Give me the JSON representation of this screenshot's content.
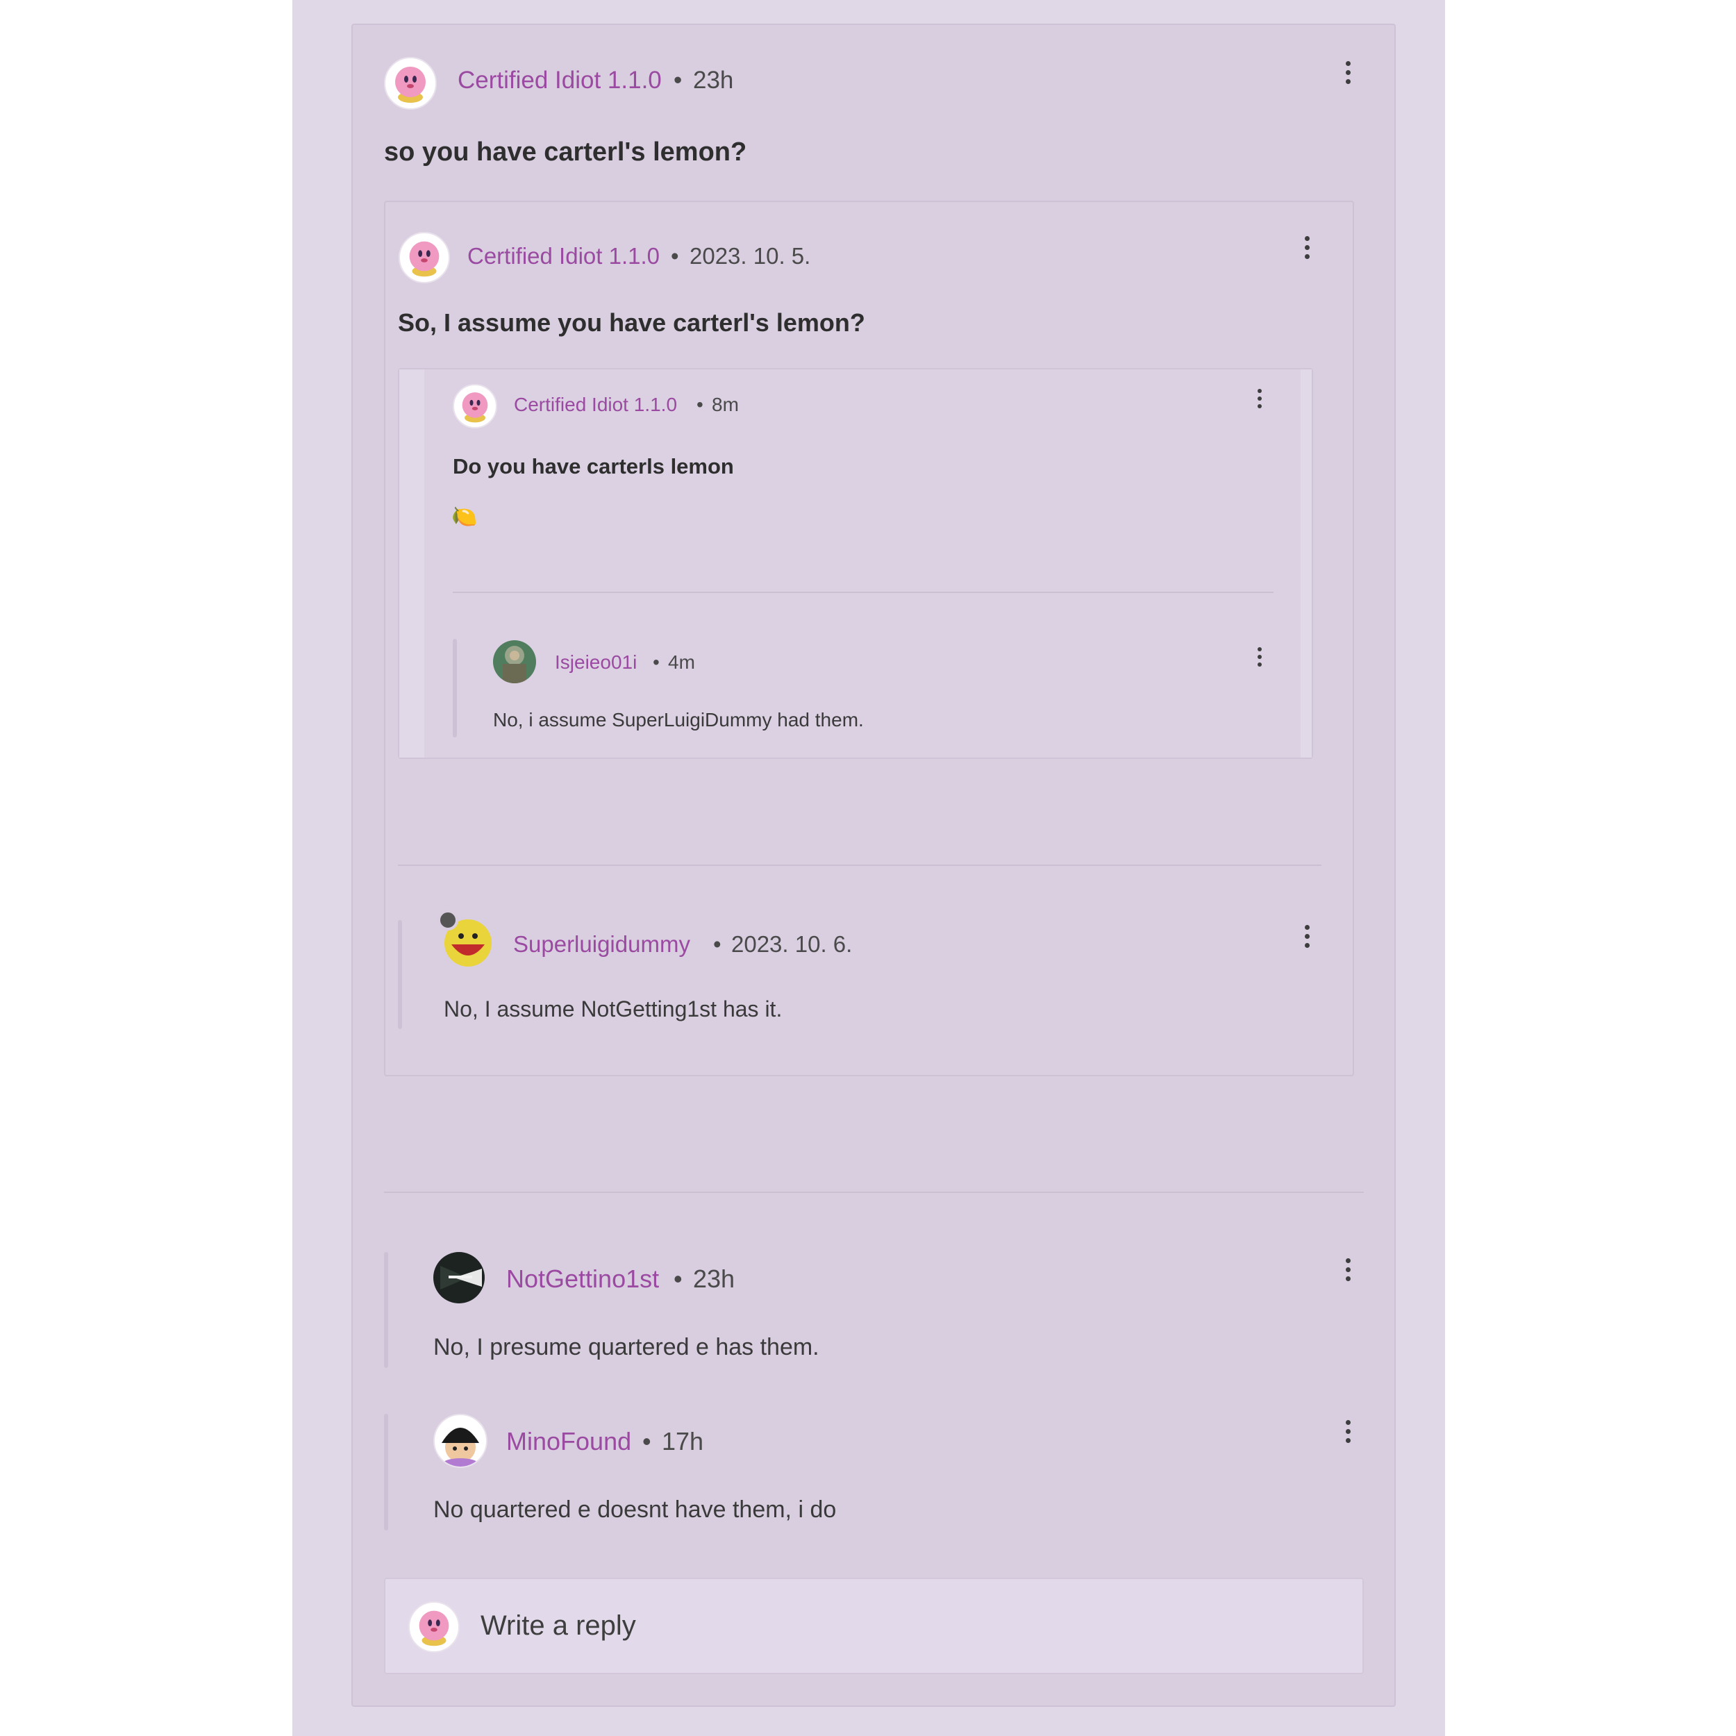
{
  "thread": {
    "main": {
      "user": "Certified Idiot 1.1.0",
      "sep": "•",
      "time": "23h",
      "title": "so you have carterl's lemon?"
    },
    "quoted": {
      "user": "Certified Idiot 1.1.0",
      "sep": "•",
      "time": "2023. 10. 5.",
      "title": "So, I assume you have carterl's lemon?",
      "nested": {
        "user": "Certified Idiot 1.1.0",
        "sep": "•",
        "time": "8m",
        "title": "Do you have carterls lemon",
        "emoji": "🍋",
        "reply": {
          "user": "Isjeieo01i",
          "sep": "•",
          "time": "4m",
          "text": "No, i assume SuperLuigiDummy had them."
        }
      },
      "reply": {
        "user": "Superluigidummy",
        "sep": "•",
        "time": "2023. 10. 6.",
        "text": "No, I assume NotGetting1st has it."
      }
    },
    "replies": [
      {
        "user": "NotGettino1st",
        "sep": "•",
        "time": "23h",
        "text": "No, I presume quartered e has them."
      },
      {
        "user": "MinoFound",
        "sep": "•",
        "time": "17h",
        "text": "No quartered e doesnt have them, i do"
      }
    ],
    "reply_box": {
      "placeholder": "Write a reply"
    }
  },
  "colors": {
    "username": "#9a4aa0",
    "card_bg": "#d9cde0",
    "page_bg": "#e0d7e7"
  },
  "icons": [
    "kirby-avatar-icon",
    "more-vertical-icon",
    "lemon-emoji",
    "gear-badge-icon"
  ]
}
